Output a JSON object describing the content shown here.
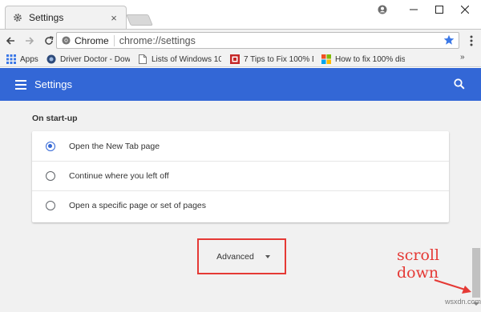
{
  "tab": {
    "title": "Settings"
  },
  "toolbar": {
    "chip_label": "Chrome",
    "url": "chrome://settings"
  },
  "bookmarks": [
    {
      "label": "Apps",
      "icon": "apps-grid-icon"
    },
    {
      "label": "Driver Doctor - Down",
      "icon": "driver-doctor-icon"
    },
    {
      "label": "Lists of Windows 10 I",
      "icon": "page-icon"
    },
    {
      "label": "7 Tips to Fix 100% Di",
      "icon": "red-site-icon"
    },
    {
      "label": "How to fix 100% disk",
      "icon": "windows-logo-icon"
    }
  ],
  "header": {
    "title": "Settings"
  },
  "startup": {
    "title": "On start-up",
    "options": [
      {
        "label": "Open the New Tab page",
        "checked": true
      },
      {
        "label": "Continue where you left off",
        "checked": false
      },
      {
        "label": "Open a specific page or set of pages",
        "checked": false
      }
    ]
  },
  "advanced": {
    "label": "Advanced"
  },
  "annotation": {
    "line1": "scroll",
    "line2": "down"
  },
  "watermark": "wsxdn.com",
  "colors": {
    "header_blue": "#3367d6",
    "annotation_red": "#e53935",
    "content_bg": "#f1f1f1"
  }
}
